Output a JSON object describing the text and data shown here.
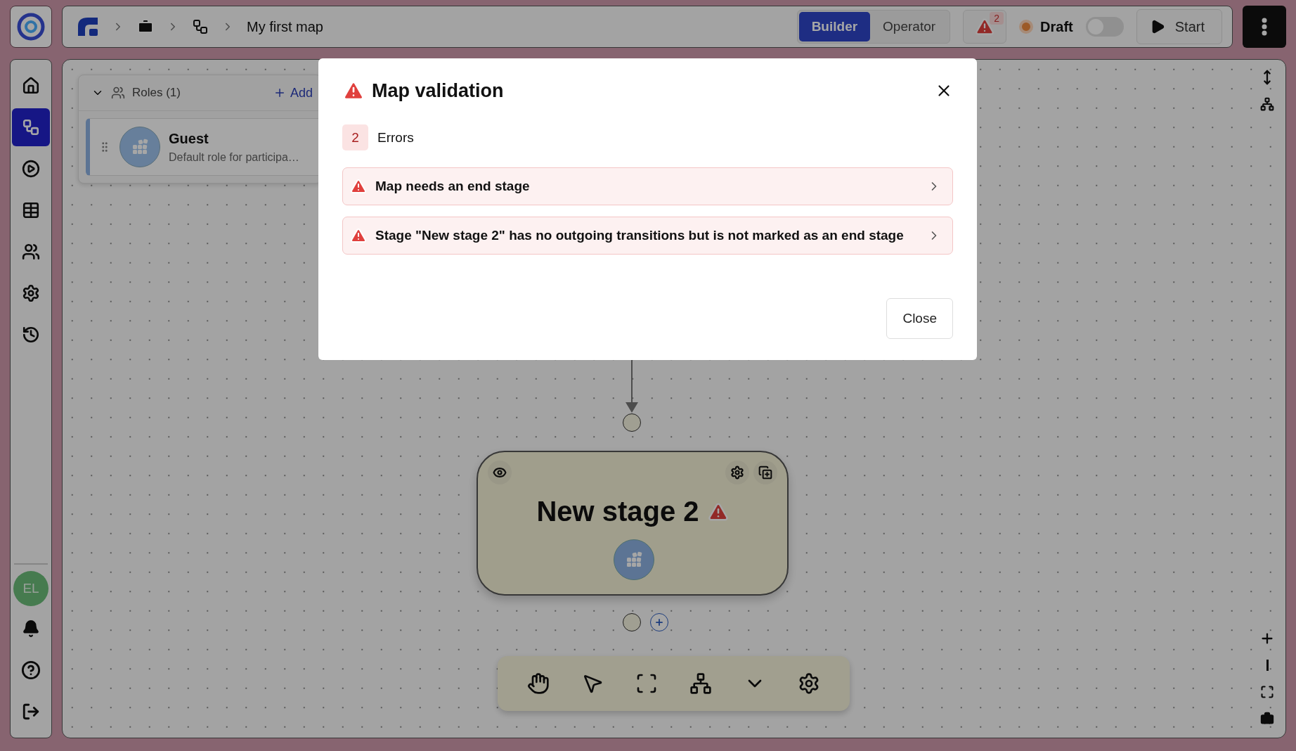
{
  "header": {
    "title": "My first map",
    "alert_count": "2",
    "status": {
      "label": "Draft",
      "on": false
    },
    "start_label": "Start"
  },
  "mode_tabs": [
    {
      "label": "Builder",
      "selected": true
    },
    {
      "label": "Operator",
      "selected": false
    }
  ],
  "sidebar": {
    "items": [
      {
        "selected": false
      },
      {
        "selected": true
      },
      {
        "selected": false
      },
      {
        "selected": false
      },
      {
        "selected": false
      },
      {
        "selected": false
      },
      {
        "selected": false
      }
    ],
    "avatar": "EL"
  },
  "roles_panel": {
    "title": "Roles (1)",
    "expanded": true,
    "add_label": "Add",
    "roles": [
      {
        "name": "Guest",
        "description": "Default role for participa…"
      }
    ]
  },
  "stage": {
    "title": "New stage 2",
    "has_warning": true
  },
  "dialog": {
    "title": "Map validation",
    "error_count": "2",
    "error_label": "Errors",
    "errors": [
      "Map needs an end stage",
      "Stage \"New stage 2\" has no outgoing transitions but is not marked as an end stage"
    ],
    "close_label": "Close"
  }
}
